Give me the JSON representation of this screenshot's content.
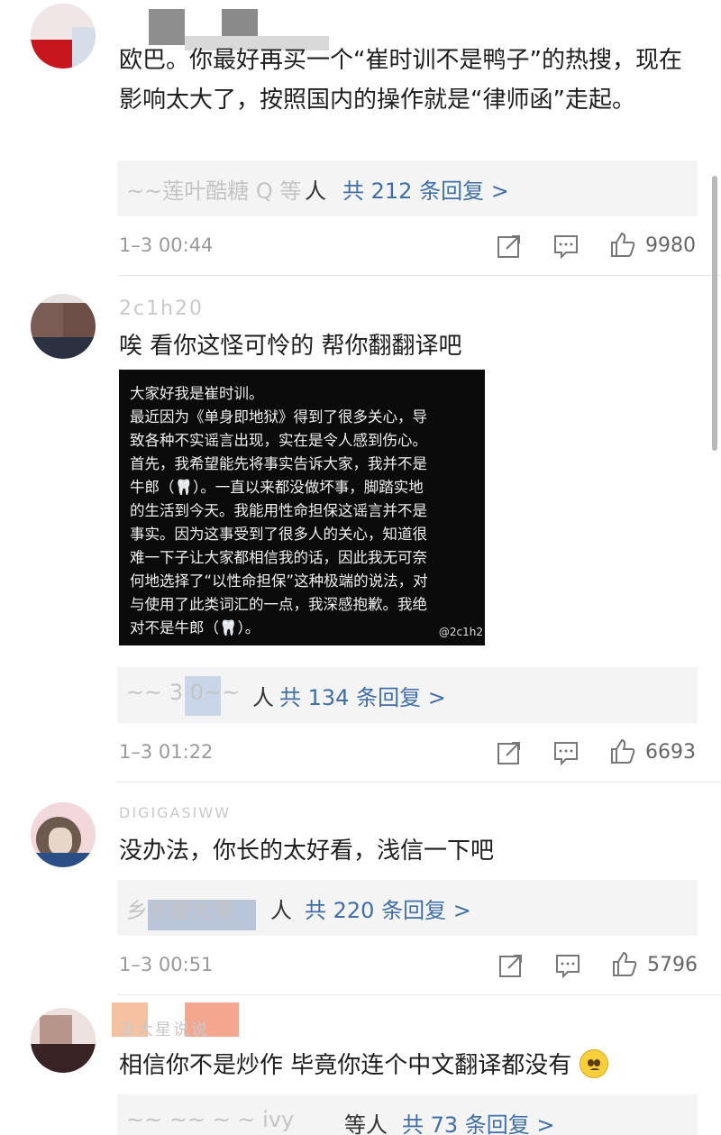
{
  "comments": [
    {
      "text": "欧巴。你最好再买一个“崔时训不是鸭子”的热搜，现在影响太大了，按照国内的操作就是“律师函”走起。",
      "reply_names": "~~莲叶酷糖 Q 等",
      "reply_suffix": "人",
      "reply_link": "共 212 条回复 >",
      "time": "1–3 00:44",
      "likes": "9980"
    },
    {
      "username": "2c1h20",
      "text": "唉 看你这怪可怜的 帮你翻翻译吧",
      "image_lines": [
        "大家好我是崔时训。",
        "最近因为《单身即地狱》得到了很多关心，导",
        "致各种不实谣言出现，实在是令人感到伤心。",
        "首先，我希望能先将事实告诉大家，我并不是",
        "牛郎（🦷）。一直以来都没做坏事，脚踏实地",
        "的生活到今天。我能用性命担保这谣言并不是",
        "事实。因为这事受到了很多人的关心，知道很",
        "难一下子让大家都相信我的话，因此我无可奈",
        "何地选择了“以性命担保”这种极端的说法，对",
        "与使用了此类词汇的一点，我深感抱歉。我绝",
        "对不是牛郎（🦷）。"
      ],
      "image_watermark": "@2c1h2",
      "reply_names": "~~ 3 0~~",
      "reply_suffix": "人",
      "reply_link": "共 134 条回复 >",
      "time": "1–3 01:22",
      "likes": "6693"
    },
    {
      "username": "DIGIGASIWW",
      "text": "没办法，你长的太好看，浅信一下吧",
      "reply_names": "乡乡雷大等",
      "reply_suffix": "人",
      "reply_link": "共 220 条回复 >",
      "time": "1–3 00:51",
      "likes": "5796"
    },
    {
      "username": "派大星说说",
      "text": "相信你不是炒作 毕竟你连个中文翻译都没有",
      "reply_names": "~~ ~~ ~ ~ ivy",
      "reply_suffix": "等人",
      "reply_link": "共 73 条回复 >"
    }
  ],
  "icons": {
    "share": "share-icon",
    "comment": "comment-icon",
    "like": "thumbs-up-icon"
  },
  "colors": {
    "link": "#3f6fa6",
    "reply_bg": "#f4f4f4",
    "meta": "#9a9a9a"
  }
}
